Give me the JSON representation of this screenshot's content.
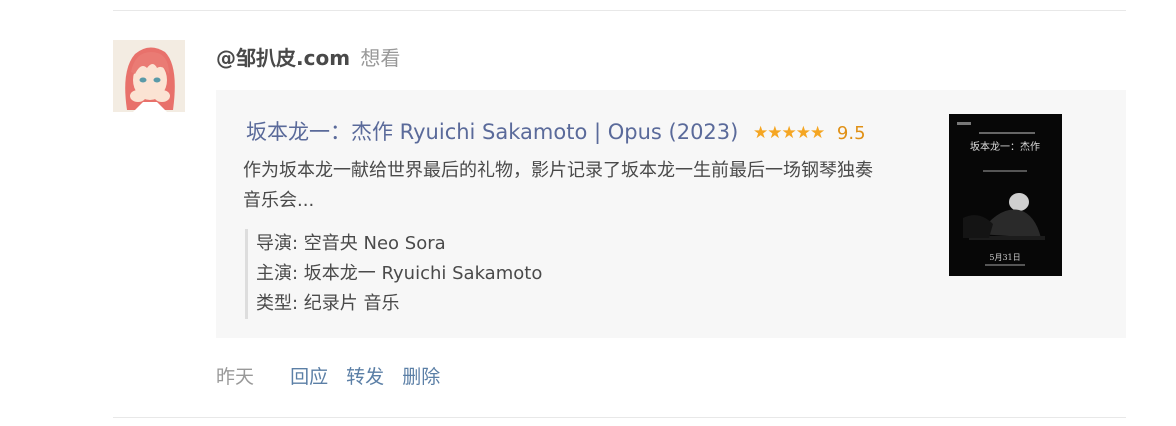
{
  "status": {
    "user_name": "@邹扒皮.com",
    "action": "想看",
    "time": "昨天"
  },
  "movie": {
    "title": "坂本龙一：杰作 Ryuichi Sakamoto | Opus (2023)",
    "stars": "★★★★★",
    "rating": "9.5",
    "summary": "作为坂本龙一献给世界最后的礼物，影片记录了坂本龙一生前最后一场钢琴独奏音乐会...",
    "director": "导演: 空音央 Neo Sora",
    "cast": "主演: 坂本龙一 Ryuichi Sakamoto",
    "genre": "类型: 纪录片 音乐"
  },
  "poster": {
    "title": "坂本龙一：杰作",
    "date": "5月31日"
  },
  "actions": {
    "reply": "回应",
    "share": "转发",
    "delete": "删除"
  },
  "colors": {
    "link": "#5b7fa6",
    "title": "#5a6a9a",
    "star": "#f5a623",
    "card_bg": "#f7f7f7"
  }
}
